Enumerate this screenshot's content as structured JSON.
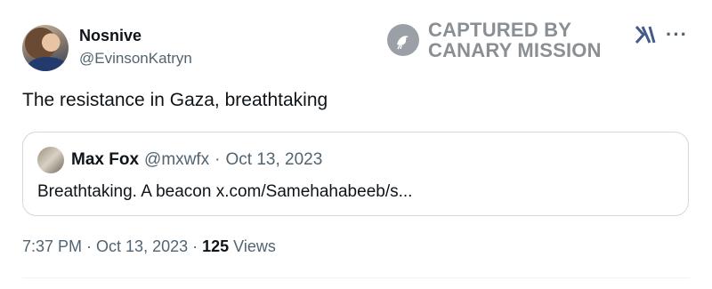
{
  "author": {
    "display_name": "Nosnive",
    "handle": "@EvinsonKatryn"
  },
  "watermark": {
    "line1": "CAPTURED BY",
    "line2": "CANARY MISSION"
  },
  "header_icons": {
    "x_logo": "x-logo-icon",
    "more": "more-options-icon",
    "x_logo_text": "X",
    "more_text": "···"
  },
  "tweet": {
    "text": "The resistance in Gaza, breathtaking"
  },
  "quoted_tweet": {
    "display_name": "Max Fox",
    "handle": "@mxwfx",
    "separator": "·",
    "date": "Oct 13, 2023",
    "text": "Breathtaking. A beacon x.com/Samehahabeeb/s..."
  },
  "meta": {
    "time": "7:37 PM",
    "separator": "·",
    "date": "Oct 13, 2023",
    "views_count": "125",
    "views_label": "Views"
  },
  "colors": {
    "primary_text": "#0f1419",
    "secondary_text": "#536471",
    "border": "#cfd9de",
    "watermark": "#8a8f94"
  }
}
